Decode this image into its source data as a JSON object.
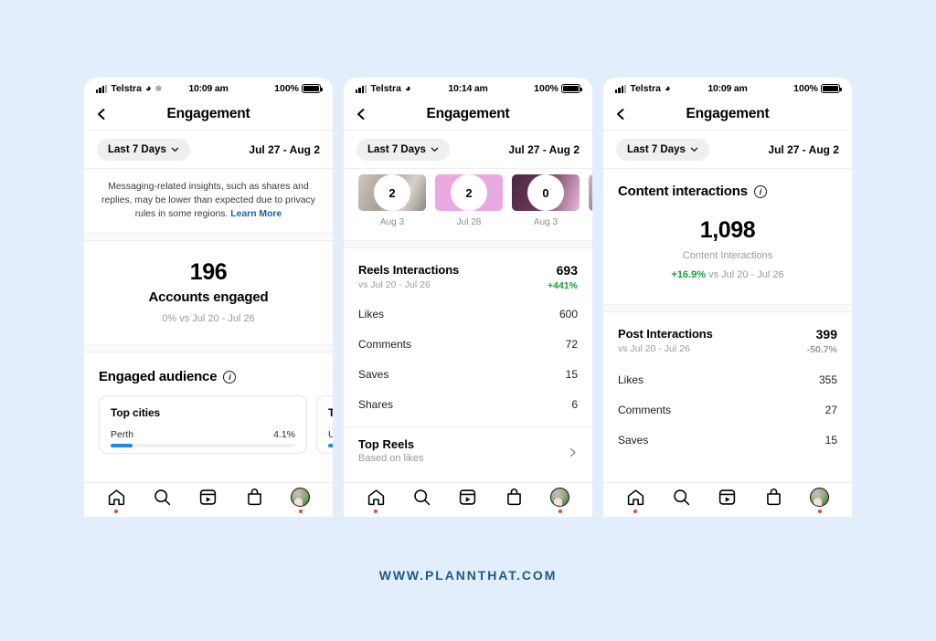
{
  "footer": {
    "url": "WWW.PLANNTHAT.COM"
  },
  "colors": {
    "background": "#e3eefd",
    "link_blue": "#1c5fa8",
    "positive_green": "#1f9d3d",
    "negative_gray": "#9a9a9a",
    "bar_blue": "#1b8bf0",
    "badge_red": "#e5403a",
    "footer_blue": "#1d5a86"
  },
  "tabbar": {
    "items": [
      {
        "name": "home",
        "icon": "home-icon",
        "badge": true
      },
      {
        "name": "search",
        "icon": "search-icon",
        "badge": false
      },
      {
        "name": "reels",
        "icon": "reels-icon",
        "badge": false
      },
      {
        "name": "shop",
        "icon": "shop-icon",
        "badge": false
      },
      {
        "name": "profile",
        "icon": "profile-avatar",
        "badge": true
      }
    ]
  },
  "phones": [
    {
      "id": "phone-1",
      "status": {
        "carrier": "Telstra",
        "time": "10:09 am",
        "battery": "100%",
        "wifi": "wifi-icon",
        "extra_icon": "snowflake-icon"
      },
      "nav": {
        "back": "back-chevron-icon",
        "title": "Engagement"
      },
      "filter": {
        "pill_label": "Last 7 Days",
        "chevron": "chevron-down-icon",
        "date_range": "Jul 27 - Aug 2"
      },
      "notice": {
        "text": "Messaging-related insights, such as shares and replies, may be lower than expected due to privacy rules in some regions. ",
        "link": "Learn More"
      },
      "big_stat": {
        "value": "196",
        "label": "Accounts engaged",
        "delta": "0% vs Jul 20 - Jul 26"
      },
      "section": {
        "title": "Engaged audience",
        "info": "info-icon"
      },
      "cards": [
        {
          "title": "Top cities",
          "rows": [
            {
              "label": "Perth",
              "value": "4.1%",
              "pct": 34
            }
          ]
        },
        {
          "title": "T",
          "rows": [
            {
              "label": "U",
              "value": "",
              "pct": 30
            }
          ]
        }
      ]
    },
    {
      "id": "phone-2",
      "status": {
        "carrier": "Telstra",
        "time": "10:14 am",
        "battery": "100%",
        "wifi": "wifi-icon",
        "extra_icon": ""
      },
      "nav": {
        "back": "back-chevron-icon",
        "title": "Engagement"
      },
      "filter": {
        "pill_label": "Last 7 Days",
        "chevron": "chevron-down-icon",
        "date_range": "Jul 27 - Aug 2"
      },
      "thumbs": [
        {
          "count": "2",
          "date": "Aug 3",
          "style": "t-a"
        },
        {
          "count": "2",
          "date": "Jul 28",
          "style": "t-b"
        },
        {
          "count": "0",
          "date": "Aug 3",
          "style": "t-c"
        },
        {
          "count": "",
          "date": "",
          "style": "t-d"
        }
      ],
      "metric": {
        "title": "Reels Interactions",
        "sub": "vs Jul 20 - Jul 26",
        "value": "693",
        "pct": "+441%",
        "pct_sign": "pos",
        "rows": [
          {
            "label": "Likes",
            "value": "600"
          },
          {
            "label": "Comments",
            "value": "72"
          },
          {
            "label": "Saves",
            "value": "15"
          },
          {
            "label": "Shares",
            "value": "6"
          }
        ]
      },
      "link_row": {
        "title": "Top Reels",
        "sub": "Based on likes",
        "arrow": "chevron-right-icon"
      }
    },
    {
      "id": "phone-3",
      "status": {
        "carrier": "Telstra",
        "time": "10:09 am",
        "battery": "100%",
        "wifi": "wifi-icon",
        "extra_icon": ""
      },
      "nav": {
        "back": "back-chevron-icon",
        "title": "Engagement"
      },
      "filter": {
        "pill_label": "Last 7 Days",
        "chevron": "chevron-down-icon",
        "date_range": "Jul 27 - Aug 2"
      },
      "section": {
        "title": "Content interactions",
        "info": "info-icon"
      },
      "big_stat": {
        "value": "1,098",
        "label": "Content Interactions",
        "delta_pct": "+16.9%",
        "delta_rest": " vs Jul 20 - Jul 26"
      },
      "metric": {
        "title": "Post Interactions",
        "sub": "vs Jul 20 - Jul 26",
        "value": "399",
        "pct": "-50.7%",
        "pct_sign": "neg",
        "rows": [
          {
            "label": "Likes",
            "value": "355"
          },
          {
            "label": "Comments",
            "value": "27"
          },
          {
            "label": "Saves",
            "value": "15"
          }
        ]
      }
    }
  ]
}
